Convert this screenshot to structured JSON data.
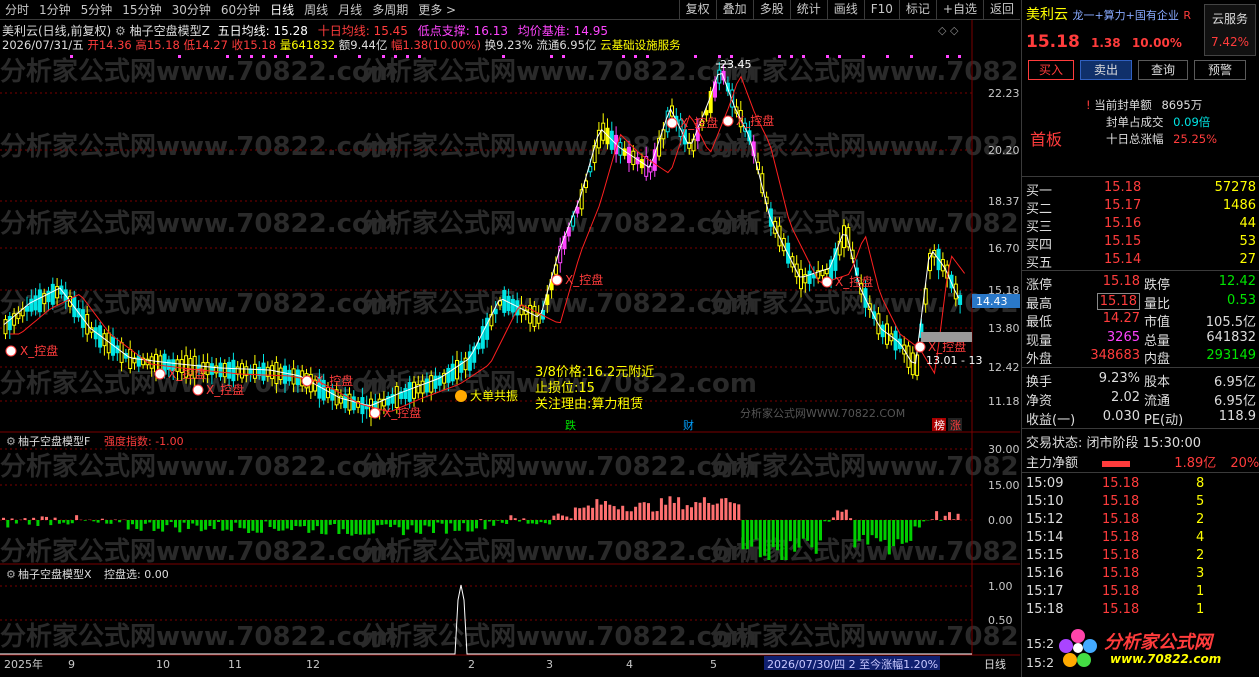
{
  "toolbar": {
    "periods": [
      "分时",
      "1分钟",
      "5分钟",
      "15分钟",
      "30分钟",
      "60分钟",
      "日线",
      "周线",
      "月线",
      "多周期",
      "更多 >"
    ],
    "right": [
      "复权",
      "叠加",
      "多股",
      "统计",
      "画线",
      "F10",
      "标记",
      "+自选",
      "返回"
    ]
  },
  "header": {
    "line1_name": "美利云(日线,前复权)",
    "line1_model": "柚子空盘模型Z",
    "line1_ma5": "五日均线: 15.28",
    "line1_ma10": "十日均线: 15.45",
    "line1_low": "低点支撑: 16.13",
    "line1_avg": "均价基准: 14.95",
    "line2_date": "2026/07/31/五",
    "line2_open": "开14.36",
    "line2_high": "高15.18",
    "line2_low": "低14.27",
    "line2_close": "收15.18",
    "line2_vol": "量641832",
    "line2_amt": "额9.44亿",
    "line2_pct": "幅1.38(10.00%)",
    "line2_turn": "换9.23%",
    "line2_circ": "流通6.95亿",
    "line2_sector": "云基础设施服务"
  },
  "price_axis": [
    "23.45",
    "22.23",
    "20.20",
    "18.37",
    "16.70",
    "15.18",
    "14.43",
    "13.80",
    "12.42",
    "11.18"
  ],
  "annotations": {
    "kp": "X_控盘",
    "high": "23.45",
    "low": "13.01 - 13",
    "note1": "3/8价格:16.2元附近",
    "note2": "止损位:15",
    "note3": "关注理由:算力租赁",
    "big": "大单共振",
    "die": "跌",
    "cai": "财",
    "bang": "榜",
    "zhang": "涨",
    "wm_caption": "分析家公式网WWW.70822.COM"
  },
  "panel2": {
    "title": "柚子空盘模型F",
    "indicator": "强度指数: -1.00",
    "axis": [
      "30.00",
      "15.00",
      "0.00"
    ]
  },
  "panel3": {
    "title": "柚子空盘模型X",
    "indicator": "控盘选: 0.00",
    "axis": [
      "1.00",
      "0.50"
    ]
  },
  "timeline": {
    "labels": [
      "2025年",
      "9",
      "10",
      "11",
      "12",
      "2",
      "3",
      "4",
      "5"
    ],
    "status": "2026/07/30/四 2 至今涨幅1.20%",
    "period": "日线"
  },
  "watermark": "分析家公式网www.70822.com",
  "right_panel": {
    "stock_name": "美利云",
    "concept": "龙一+算力+国有企业",
    "r_tag": "R",
    "cloud": "云服务",
    "cloud_pct": "7.42%",
    "price": "15.18",
    "chg": "1.38",
    "pct": "10.00%",
    "buy": "买入",
    "sell": "卖出",
    "query": "查询",
    "alert": "预警",
    "seal_amt_l": "当前封单额",
    "seal_amt_v": "8695万",
    "seal_ratio_l": "封单占成交",
    "seal_ratio_v": "0.09倍",
    "ten_l": "十日总涨幅",
    "ten_v": "25.25%",
    "first": "首板",
    "bids": [
      {
        "l": "买一",
        "p": "15.18",
        "v": "57278"
      },
      {
        "l": "买二",
        "p": "15.17",
        "v": "1486"
      },
      {
        "l": "买三",
        "p": "15.16",
        "v": "44"
      },
      {
        "l": "买四",
        "p": "15.15",
        "v": "53"
      },
      {
        "l": "买五",
        "p": "15.14",
        "v": "27"
      }
    ],
    "stats": [
      {
        "l": "涨停",
        "v": "15.18",
        "l2": "跌停",
        "v2": "12.42"
      },
      {
        "l": "最高",
        "v": "15.18",
        "l2": "量比",
        "v2": "0.53"
      },
      {
        "l": "最低",
        "v": "14.27",
        "l2": "市值",
        "v2": "105.5亿"
      },
      {
        "l": "现量",
        "v": "3265",
        "l2": "总量",
        "v2": "641832"
      },
      {
        "l": "外盘",
        "v": "348683",
        "l2": "内盘",
        "v2": "293149"
      }
    ],
    "fund": [
      {
        "l": "换手",
        "v": "9.23%",
        "l2": "股本",
        "v2": "6.95亿"
      },
      {
        "l": "净资",
        "v": "2.02",
        "l2": "流通",
        "v2": "6.95亿"
      },
      {
        "l": "收益(一)",
        "v": "0.030",
        "l2": "PE(动)",
        "v2": "118.9"
      }
    ],
    "trade_state": "交易状态: 闭市阶段 15:30:00",
    "main_net_l": "主力净额",
    "main_net_v": "1.89亿",
    "main_net_p": "20%",
    "ticks": [
      {
        "t": "15:09",
        "p": "15.18",
        "v": "8"
      },
      {
        "t": "15:10",
        "p": "15.18",
        "v": "5"
      },
      {
        "t": "15:12",
        "p": "15.18",
        "v": "2"
      },
      {
        "t": "15:14",
        "p": "15.18",
        "v": "4"
      },
      {
        "t": "15:15",
        "p": "15.18",
        "v": "2"
      },
      {
        "t": "15:16",
        "p": "15.18",
        "v": "3"
      },
      {
        "t": "15:17",
        "p": "15.18",
        "v": "1"
      },
      {
        "t": "15:18",
        "p": "15.18",
        "v": "1"
      }
    ],
    "logo": "分析家公式网",
    "logo_url": "www.70822.com",
    "tick_tail1": "15:2",
    "tick_tail2": "15:2"
  },
  "colors": {
    "up": "#ff3c3c",
    "down": "#00e5e5",
    "yellow": "#ffff00",
    "magenta": "#ff44ff",
    "ma": "#ffffff",
    "ma10": "#ff2020",
    "green": "#00ff00"
  }
}
